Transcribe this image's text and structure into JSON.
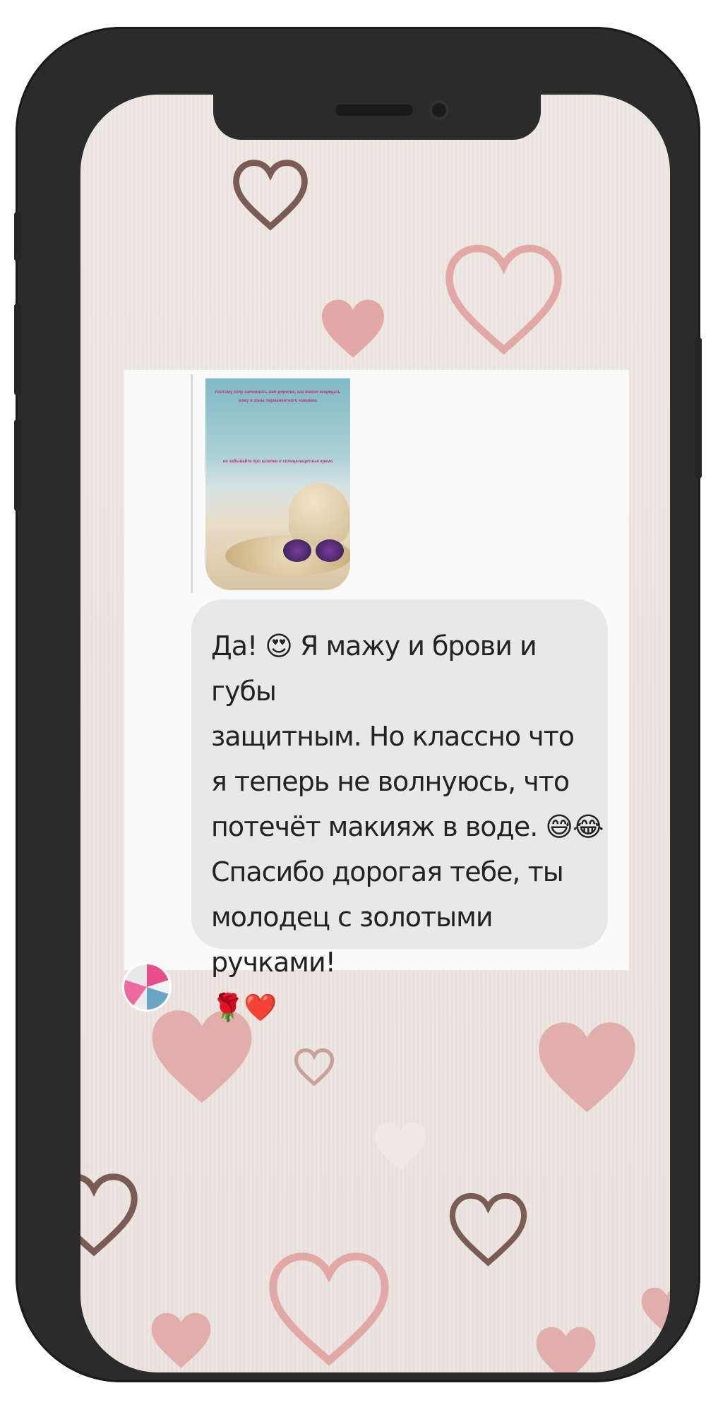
{
  "message": {
    "text_lines": [
      "Да! 😍 Я мажу и брови и губы",
      "защитным. Но классно что",
      "я теперь не волнуюсь, что",
      "потечёт макияж в воде. 😅😂",
      "Спасибо дорогая тебе, ты",
      "молодец с золотыми ручками!",
      "🌹❤️"
    ]
  },
  "quoted_image": {
    "caption_top": "поэтому хочу напомнить вам дорогие, как важно защищать кожу и зоны перманентного макияжа",
    "caption_bottom": "не забывайте про шляпки и солнцезащитные крема",
    "icon": "beach-hat-sunglasses-image"
  },
  "colors": {
    "phone_frame": "#2b2b2b",
    "background": "#ece5e0",
    "bubble": "#e8e8e8",
    "heart_pink": "#e2a8a6",
    "heart_brown": "#7a5c55"
  }
}
